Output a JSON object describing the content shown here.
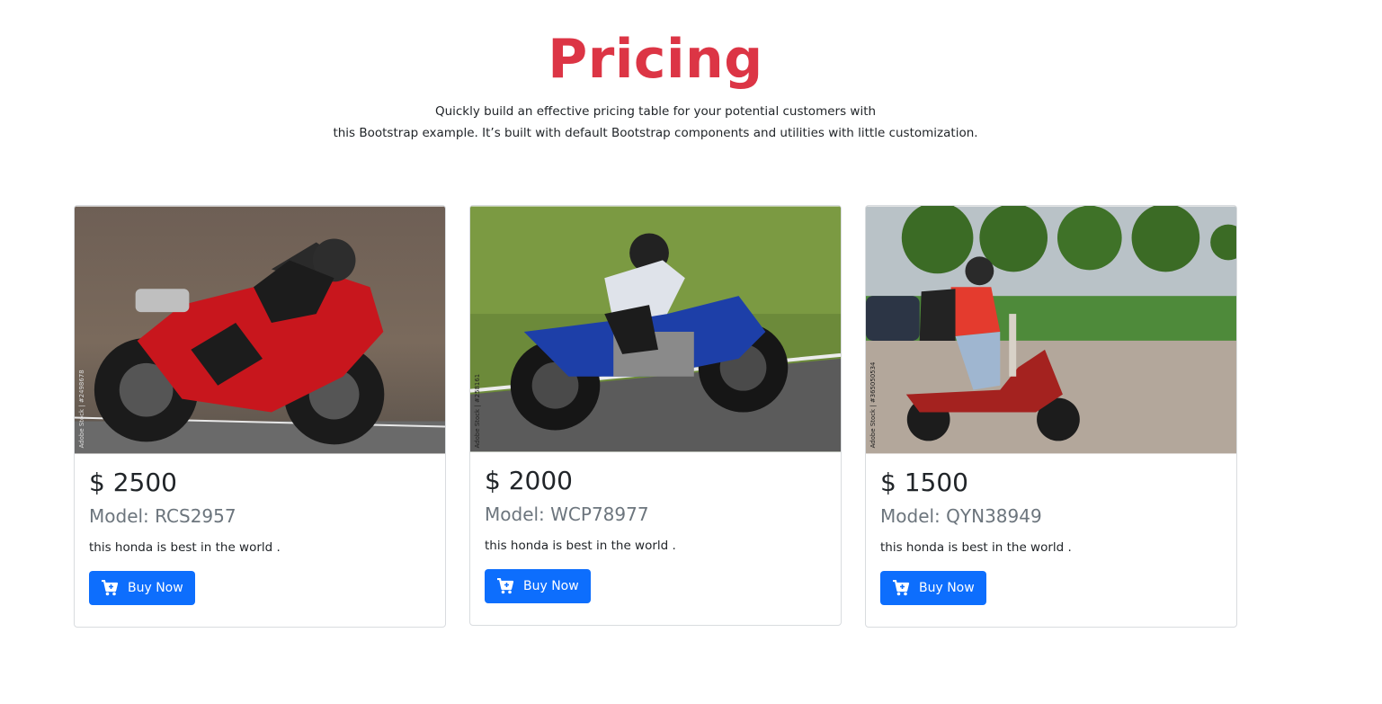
{
  "header": {
    "title": "Pricing",
    "lead_line1": "Quickly build an effective pricing table for your potential customers with",
    "lead_line2": "this Bootstrap example. It’s built with default Bootstrap components and utilities with little customization."
  },
  "cards": [
    {
      "price": "$ 2500",
      "model": "Model: RCS2957",
      "description": "this honda is best in the world .",
      "button_label": "Buy Now",
      "image_watermark": "Adobe Stock | #2498678",
      "bike_color": "#c8161d"
    },
    {
      "price": "$ 2000",
      "model": "Model: WCP78977",
      "description": "this honda is best in the world .",
      "button_label": "Buy Now",
      "image_watermark": "Adobe Stock | #258161",
      "bike_color": "#1d3fa8"
    },
    {
      "price": "$ 1500",
      "model": "Model: QYN38949",
      "description": "this honda is best in the world .",
      "button_label": "Buy Now",
      "image_watermark": "Adobe Stock | #365050534",
      "bike_color": "#a4221f"
    }
  ],
  "colors": {
    "title": "#dc3545",
    "primary_button": "#0d6efd",
    "muted_text": "#6c757d"
  },
  "icons": {
    "buy_button_icon": "cart-plus-icon"
  }
}
